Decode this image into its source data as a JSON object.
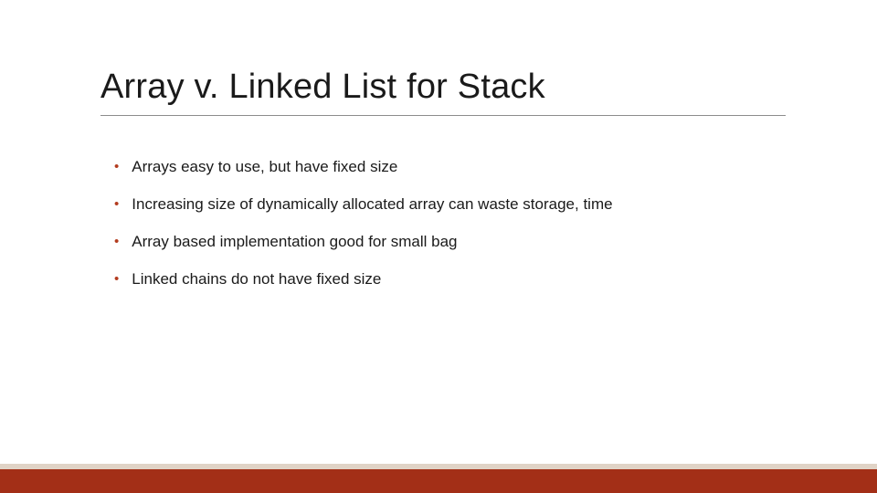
{
  "title": "Array v. Linked List for Stack",
  "bullets": [
    {
      "text": "Arrays easy to use, but have fixed size"
    },
    {
      "text": "Increasing size of dynamically allocated array can waste storage, time"
    },
    {
      "text": "Array based implementation good for small bag"
    },
    {
      "text": "Linked chains do not have fixed size"
    }
  ]
}
